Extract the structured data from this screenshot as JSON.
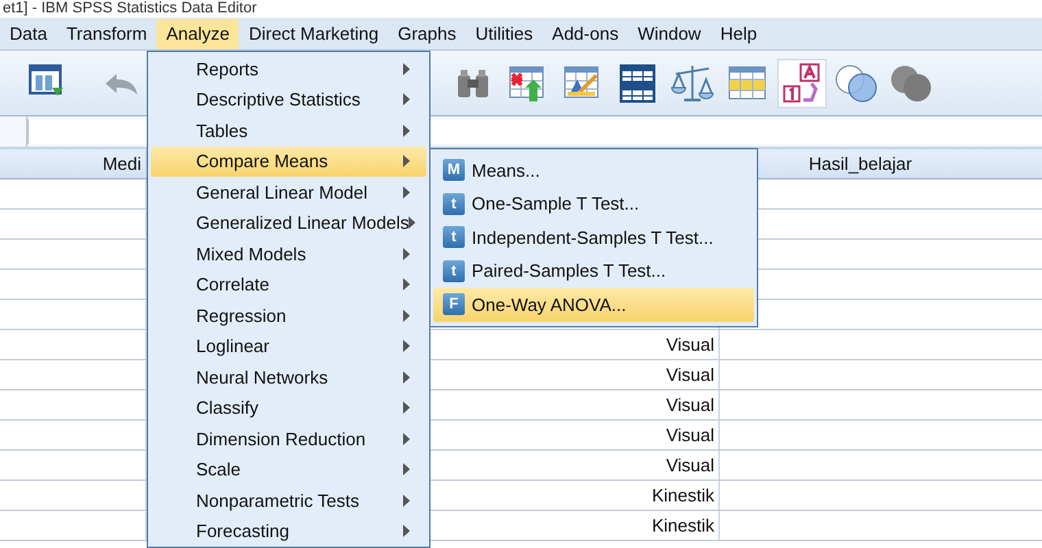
{
  "window": {
    "title": "et1] - IBM SPSS Statistics Data Editor"
  },
  "menu_bar": [
    {
      "label": "Data",
      "selected": false
    },
    {
      "label": "Transform",
      "selected": false
    },
    {
      "label": "Analyze",
      "selected": true
    },
    {
      "label": "Direct Marketing",
      "selected": false
    },
    {
      "label": "Graphs",
      "selected": false
    },
    {
      "label": "Utilities",
      "selected": false
    },
    {
      "label": "Add-ons",
      "selected": false
    },
    {
      "label": "Window",
      "selected": false
    },
    {
      "label": "Help",
      "selected": false
    }
  ],
  "toolbar": {
    "left": [
      {
        "kind": "dataview",
        "selected": false
      },
      {
        "kind": "undo",
        "selected": false
      }
    ],
    "right": [
      {
        "kind": "binoculars",
        "selected": false
      },
      {
        "kind": "insertcases",
        "selected": false
      },
      {
        "kind": "editgrid",
        "selected": false
      },
      {
        "kind": "splitfile",
        "selected": false
      },
      {
        "kind": "weight",
        "selected": false
      },
      {
        "kind": "selectcases",
        "selected": false
      },
      {
        "kind": "valuelabels",
        "selected": true
      },
      {
        "kind": "sets",
        "selected": false
      },
      {
        "kind": "greysets",
        "selected": false
      }
    ]
  },
  "grid": {
    "column_1_header": "Medi",
    "column_3_header": "Hasil_belajar",
    "rows": [
      {},
      {},
      {},
      {},
      {},
      {
        "column_2": "Visual"
      },
      {
        "column_2": "Visual"
      },
      {
        "column_2": "Visual"
      },
      {
        "column_2": "Visual"
      },
      {
        "column_2": "Visual"
      },
      {
        "column_2": "Kinestik"
      },
      {
        "column_2": "Kinestik"
      }
    ]
  },
  "analyze_menu": [
    {
      "label": "Reports",
      "submenu": true,
      "selected": false
    },
    {
      "label": "Descriptive Statistics",
      "submenu": true,
      "selected": false
    },
    {
      "label": "Tables",
      "submenu": true,
      "selected": false
    },
    {
      "label": "Compare Means",
      "submenu": true,
      "selected": true
    },
    {
      "label": "General Linear Model",
      "submenu": true,
      "selected": false
    },
    {
      "label": "Generalized Linear Models",
      "submenu": true,
      "selected": false
    },
    {
      "label": "Mixed Models",
      "submenu": true,
      "selected": false
    },
    {
      "label": "Correlate",
      "submenu": true,
      "selected": false
    },
    {
      "label": "Regression",
      "submenu": true,
      "selected": false
    },
    {
      "label": "Loglinear",
      "submenu": true,
      "selected": false
    },
    {
      "label": "Neural Networks",
      "submenu": true,
      "selected": false
    },
    {
      "label": "Classify",
      "submenu": true,
      "selected": false
    },
    {
      "label": "Dimension Reduction",
      "submenu": true,
      "selected": false
    },
    {
      "label": "Scale",
      "submenu": true,
      "selected": false
    },
    {
      "label": "Nonparametric Tests",
      "submenu": true,
      "selected": false
    },
    {
      "label": "Forecasting",
      "submenu": true,
      "selected": false
    }
  ],
  "compare_means_submenu": [
    {
      "icon_text": "M",
      "label": "Means...",
      "selected": false
    },
    {
      "icon_text": "t",
      "label": "One-Sample T Test...",
      "selected": false
    },
    {
      "icon_text": "t",
      "label": "Independent-Samples T Test...",
      "selected": false
    },
    {
      "icon_text": "t",
      "label": "Paired-Samples T Test...",
      "selected": false
    },
    {
      "icon_text": "F",
      "label": "One-Way ANOVA...",
      "selected": true
    }
  ]
}
